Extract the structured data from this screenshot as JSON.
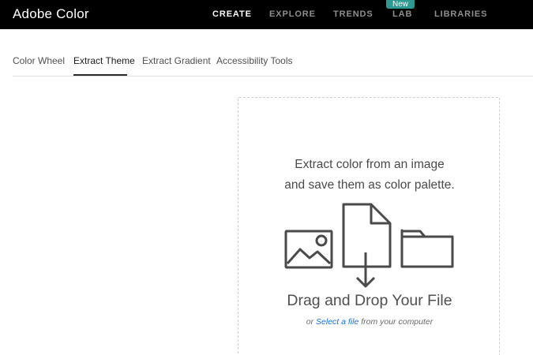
{
  "app": {
    "title": "Adobe Color"
  },
  "topnav": {
    "items": [
      {
        "label": "CREATE",
        "active": true
      },
      {
        "label": "EXPLORE",
        "active": false
      },
      {
        "label": "TRENDS",
        "active": false
      },
      {
        "label": "LAB",
        "active": false,
        "badge": "New"
      },
      {
        "label": "LIBRARIES",
        "active": false
      }
    ]
  },
  "tabs": {
    "items": [
      {
        "label": "Color Wheel",
        "active": false
      },
      {
        "label": "Extract Theme",
        "active": true
      },
      {
        "label": "Extract Gradient",
        "active": false
      },
      {
        "label": "Accessibility Tools",
        "active": false
      }
    ]
  },
  "dropzone": {
    "heading_line1": "Extract color from an image",
    "heading_line2": "and save them as color palette.",
    "title": "Drag and Drop Your File",
    "sub_before": "or ",
    "sub_link": "Select a file",
    "sub_after": " from your computer",
    "icons": [
      "image-icon",
      "file-download-icon",
      "folder-icon"
    ]
  },
  "colors": {
    "topbar_bg": "#000000",
    "badge_bg": "#2a9a92",
    "link": "#1473e6"
  }
}
